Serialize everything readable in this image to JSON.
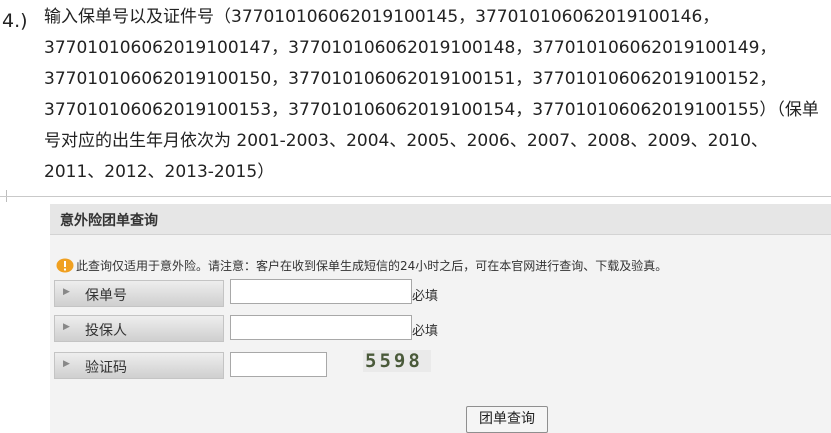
{
  "instruction": {
    "step": "4.)",
    "prefix": "输入保单号以及证件号（",
    "policy_numbers": [
      "377010106062019100145",
      "377010106062019100146",
      "377010106062019100147",
      "377010106062019100148",
      "377010106062019100149",
      "377010106062019100150",
      "377010106062019100151",
      "377010106062019100152",
      "377010106062019100153",
      "377010106062019100154",
      "377010106062019100155"
    ],
    "close_paren": "）",
    "note": "（保单号对应的出生年月依次为 2001-2003、2004、2005、2006、2007、2008、2009、2010、2011、2012、2013-2015）"
  },
  "form": {
    "title": "意外险团单查询",
    "notice": "此查询仅适用于意外险。请注意：客户在收到保单生成短信的24小时之后，可在本官网进行查询、下载及验真。",
    "fields": {
      "policy_no_label": "保单号",
      "policy_no_required": "必填",
      "applicant_label": "投保人",
      "applicant_required": "必填",
      "captcha_label": "验证码"
    },
    "captcha_value": "5598",
    "submit_label": "团单查询"
  },
  "colors": {
    "warning": "#f0a020",
    "panel_bg": "#f3f3f3",
    "header_bg": "#e6e6e6"
  }
}
